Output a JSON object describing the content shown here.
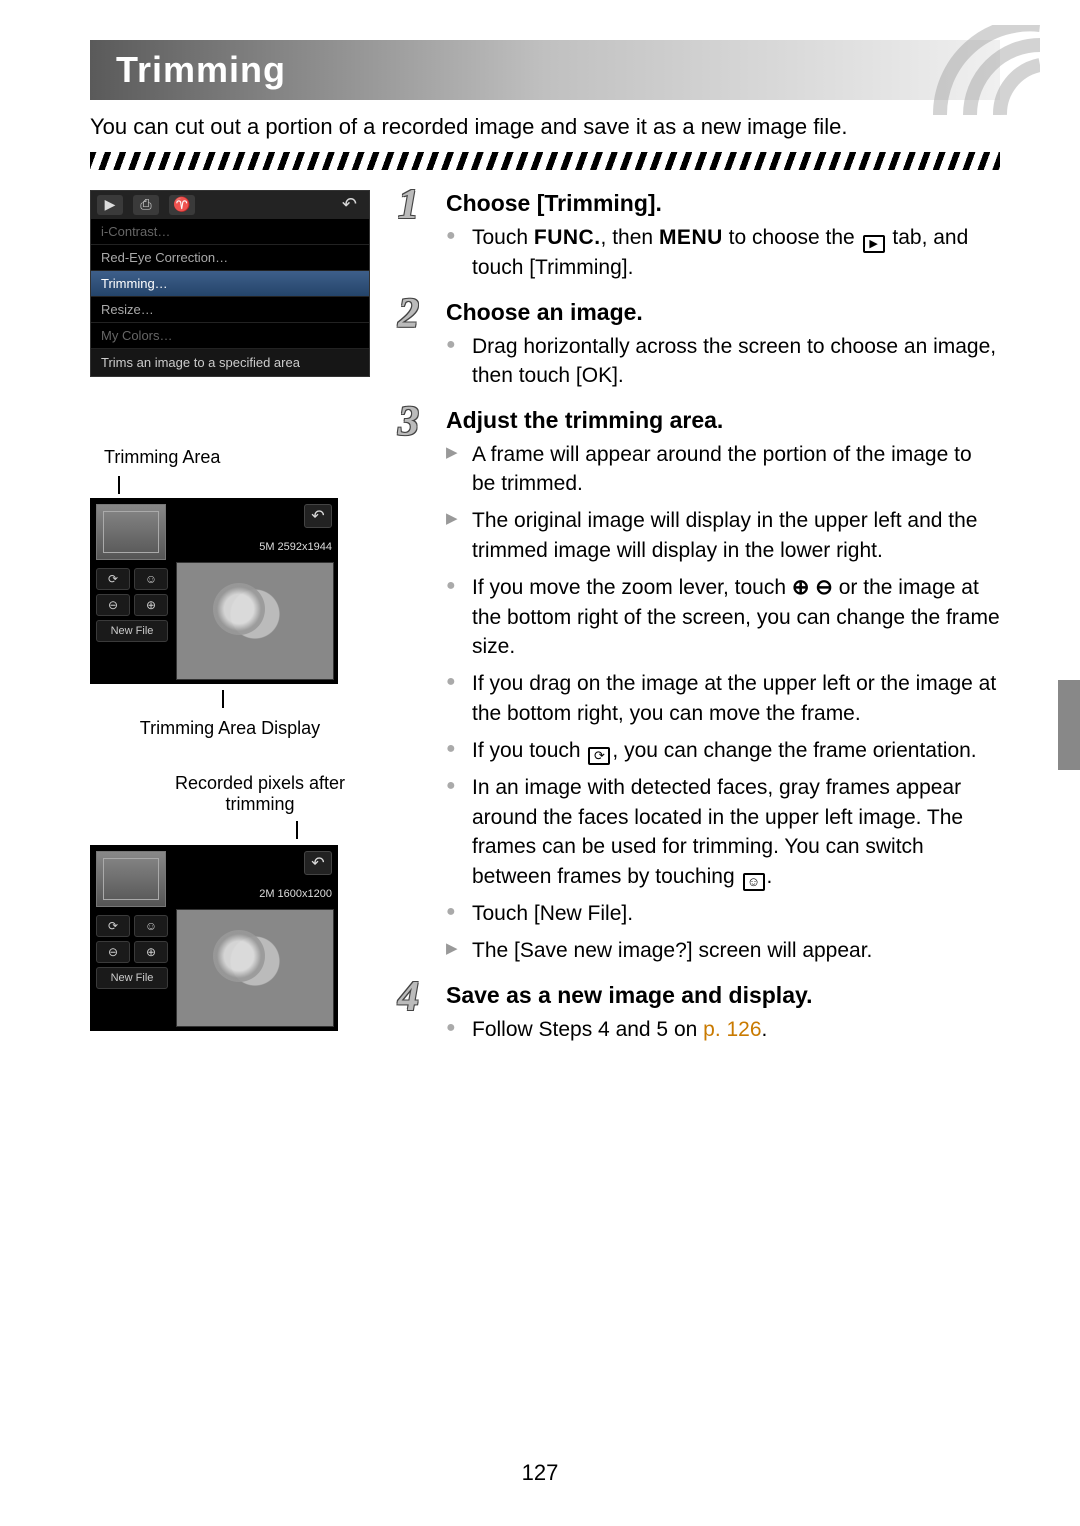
{
  "header": {
    "title": "Trimming"
  },
  "intro": "You can cut out a portion of a recorded image and save it as a new image file.",
  "menu_shot": {
    "rows": [
      "i-Contrast…",
      "Red-Eye Correction…",
      "Trimming…",
      "Resize…",
      "My Colors…"
    ],
    "hint": "Trims an image to a specified area"
  },
  "left_labels": {
    "trimming_area": "Trimming Area",
    "trimming_area_display": "Trimming Area Display",
    "recorded_px": "Recorded pixels after trimming"
  },
  "photo1": {
    "resolution": "5M 2592x1944",
    "new_file": "New File"
  },
  "photo2": {
    "resolution": "2M 1600x1200",
    "new_file": "New File"
  },
  "steps": {
    "s1": {
      "head": "Choose [Trimming].",
      "p1a": "Touch ",
      "func": "FUNC.",
      "p1b": ", then ",
      "menu": "MENU",
      "p1c": " to choose the ",
      "p1d": " tab, and touch [Trimming]."
    },
    "s2": {
      "head": "Choose an image.",
      "p1": "Drag horizontally across the screen to choose an image, then touch [OK]."
    },
    "s3": {
      "head": "Adjust the trimming area.",
      "p1": "A frame will appear around the portion of the image to be trimmed.",
      "p2": "The original image will display in the upper left and the trimmed image will display in the lower right.",
      "p3a": "If you move the zoom lever, touch ",
      "p3b": " or the image at the bottom right of the screen, you can change the frame size.",
      "p4": "If you drag on the image at the upper left or the image at the bottom right, you can move the frame.",
      "p5a": "If you touch ",
      "p5b": ", you can change the frame orientation.",
      "p6a": "In an image with detected faces, gray frames appear around the faces located in the upper left image. The frames can be used for trimming. You can switch between frames by touching ",
      "p6b": ".",
      "p7": "Touch [New File].",
      "p8": "The [Save new image?] screen will appear."
    },
    "s4": {
      "head": "Save as a new image and display.",
      "p1a": "Follow Steps 4 and 5 on ",
      "link": "p. 126",
      "p1b": "."
    }
  },
  "mag": {
    "in": "⊕",
    "out": "⊖"
  },
  "page_number": "127"
}
